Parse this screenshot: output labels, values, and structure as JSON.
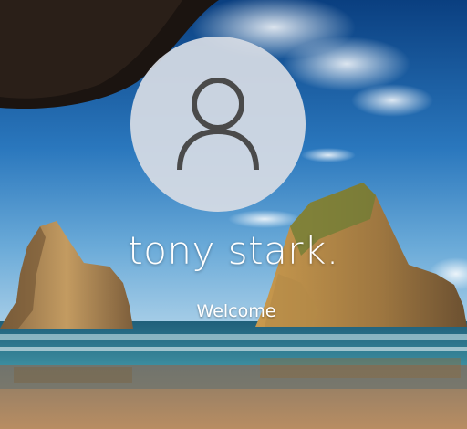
{
  "user": {
    "name": "tony stark.",
    "avatar_icon": "user-icon"
  },
  "status": {
    "text": "Welcome"
  },
  "background": {
    "description_icon": "beach-rocks-wallpaper"
  }
}
